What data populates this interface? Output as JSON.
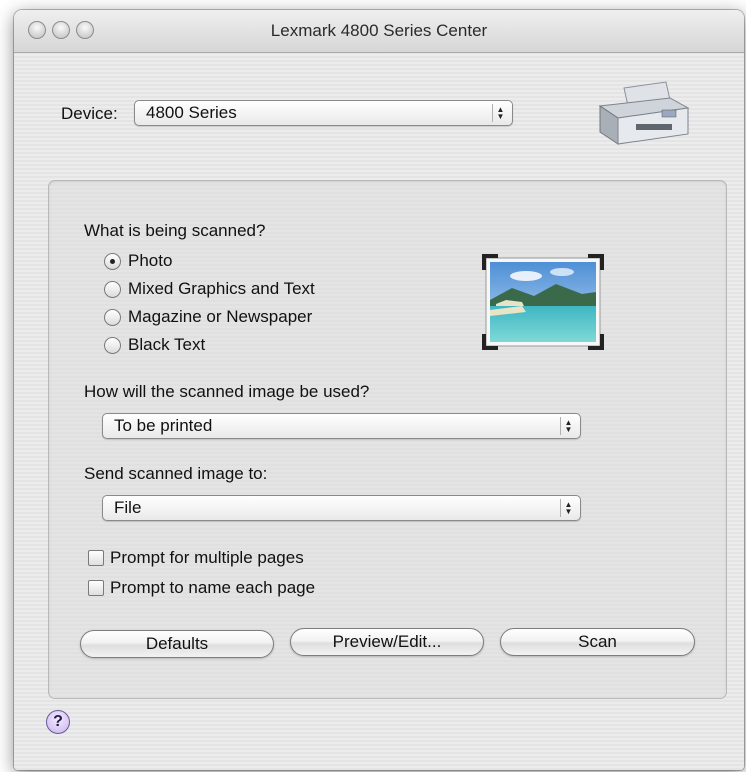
{
  "window": {
    "title": "Lexmark 4800 Series Center"
  },
  "device": {
    "label": "Device:",
    "selected": "4800 Series"
  },
  "scan_type": {
    "question": "What is being scanned?",
    "options": [
      "Photo",
      "Mixed Graphics and Text",
      "Magazine or Newspaper",
      "Black Text"
    ],
    "selected": "Photo"
  },
  "usage": {
    "question": "How will the scanned image be used?",
    "selected": "To be printed"
  },
  "destination": {
    "question": "Send scanned image to:",
    "selected": "File"
  },
  "checkboxes": [
    {
      "label": "Prompt for multiple pages",
      "checked": false
    },
    {
      "label": "Prompt to name each page",
      "checked": false
    }
  ],
  "buttons": {
    "defaults": "Defaults",
    "preview": "Preview/Edit...",
    "scan": "Scan"
  },
  "help": {
    "glyph": "?"
  }
}
